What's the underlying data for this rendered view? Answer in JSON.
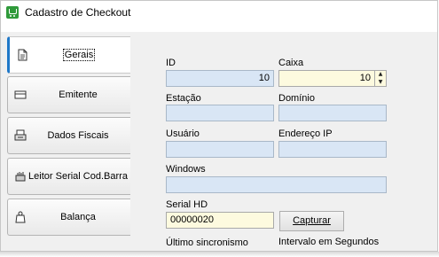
{
  "window": {
    "title": "Cadastro de Checkout",
    "icon": "cart-icon"
  },
  "tabs": [
    {
      "label": "Gerais",
      "icon": "document-icon",
      "active": true
    },
    {
      "label": "Emitente",
      "icon": "card-icon",
      "active": false
    },
    {
      "label": "Dados Fiscais",
      "icon": "fiscal-printer-icon",
      "active": false
    },
    {
      "label": "Leitor Serial Cod.Barra",
      "icon": "barcode-reader-icon",
      "active": false
    },
    {
      "label": "Balança",
      "icon": "scale-icon",
      "active": false
    }
  ],
  "form": {
    "id_label": "ID",
    "id_value": "10",
    "caixa_label": "Caixa",
    "caixa_value": "10",
    "estacao_label": "Estação",
    "estacao_value": "",
    "dominio_label": "Domínio",
    "dominio_value": "",
    "usuario_label": "Usuário",
    "usuario_value": "",
    "ip_label": "Endereço IP",
    "ip_value": "",
    "windows_label": "Windows",
    "windows_value": "",
    "serial_label": "Serial HD",
    "serial_value": "00000020",
    "capturar_label": "Capturar",
    "sync_label": "Último sincronismo",
    "intervalo_label": "Intervalo em Segundos"
  },
  "colors": {
    "active_tab_accent": "#1f78c8",
    "readonly_field": "#d9e6f5",
    "editable_field": "#fdfadf"
  }
}
